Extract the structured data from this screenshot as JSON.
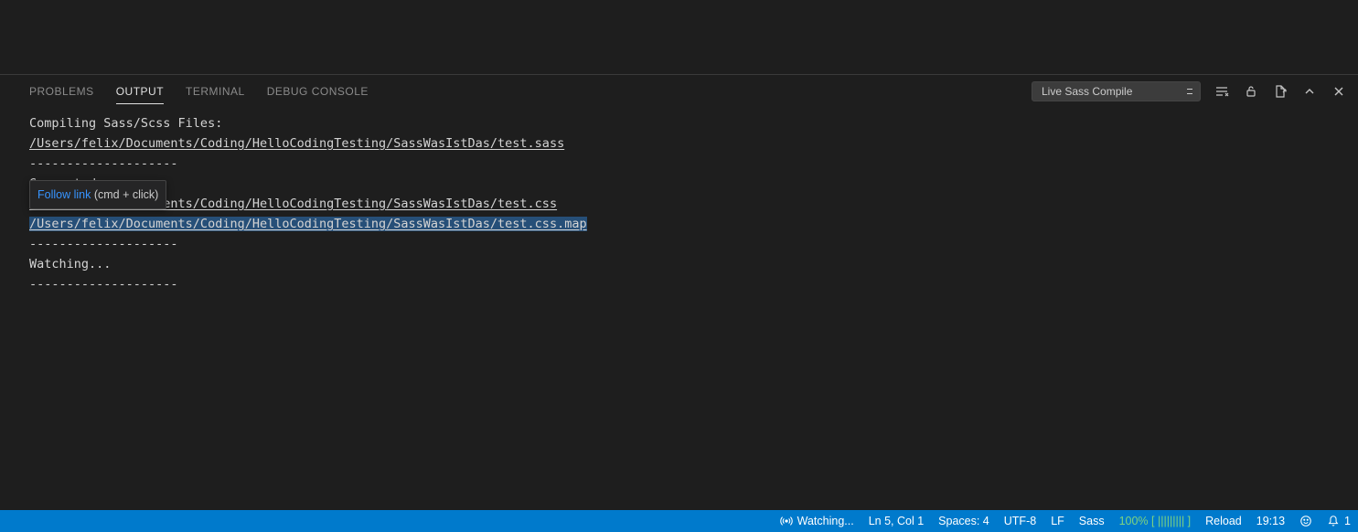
{
  "panel": {
    "tabs": {
      "problems": "PROBLEMS",
      "output": "OUTPUT",
      "terminal": "TERMINAL",
      "debug": "DEBUG CONSOLE"
    },
    "channel": "Live Sass Compile"
  },
  "output": {
    "l1": "Compiling Sass/Scss Files: ",
    "l2": "/Users/felix/Documents/Coding/HelloCodingTesting/SassWasIstDas/test.sass",
    "sep": "--------------------",
    "l4": "Generated :",
    "l5": "/Users/felix/Documents/Coding/HelloCodingTesting/SassWasIstDas/test.css",
    "l6": "/Users/felix/Documents/Coding/HelloCodingTesting/SassWasIstDas/test.css.map",
    "l8": "Watching..."
  },
  "tooltip": {
    "follow": "Follow link",
    "hint": " (cmd + click)"
  },
  "status": {
    "watching": "Watching...",
    "lncol": "Ln 5, Col 1",
    "spaces": "Spaces: 4",
    "encoding": "UTF-8",
    "eol": "LF",
    "lang": "Sass",
    "coverage": "100% [ ||||||||| ]",
    "reload": "Reload",
    "time": "19:13",
    "bellcount": "1"
  }
}
